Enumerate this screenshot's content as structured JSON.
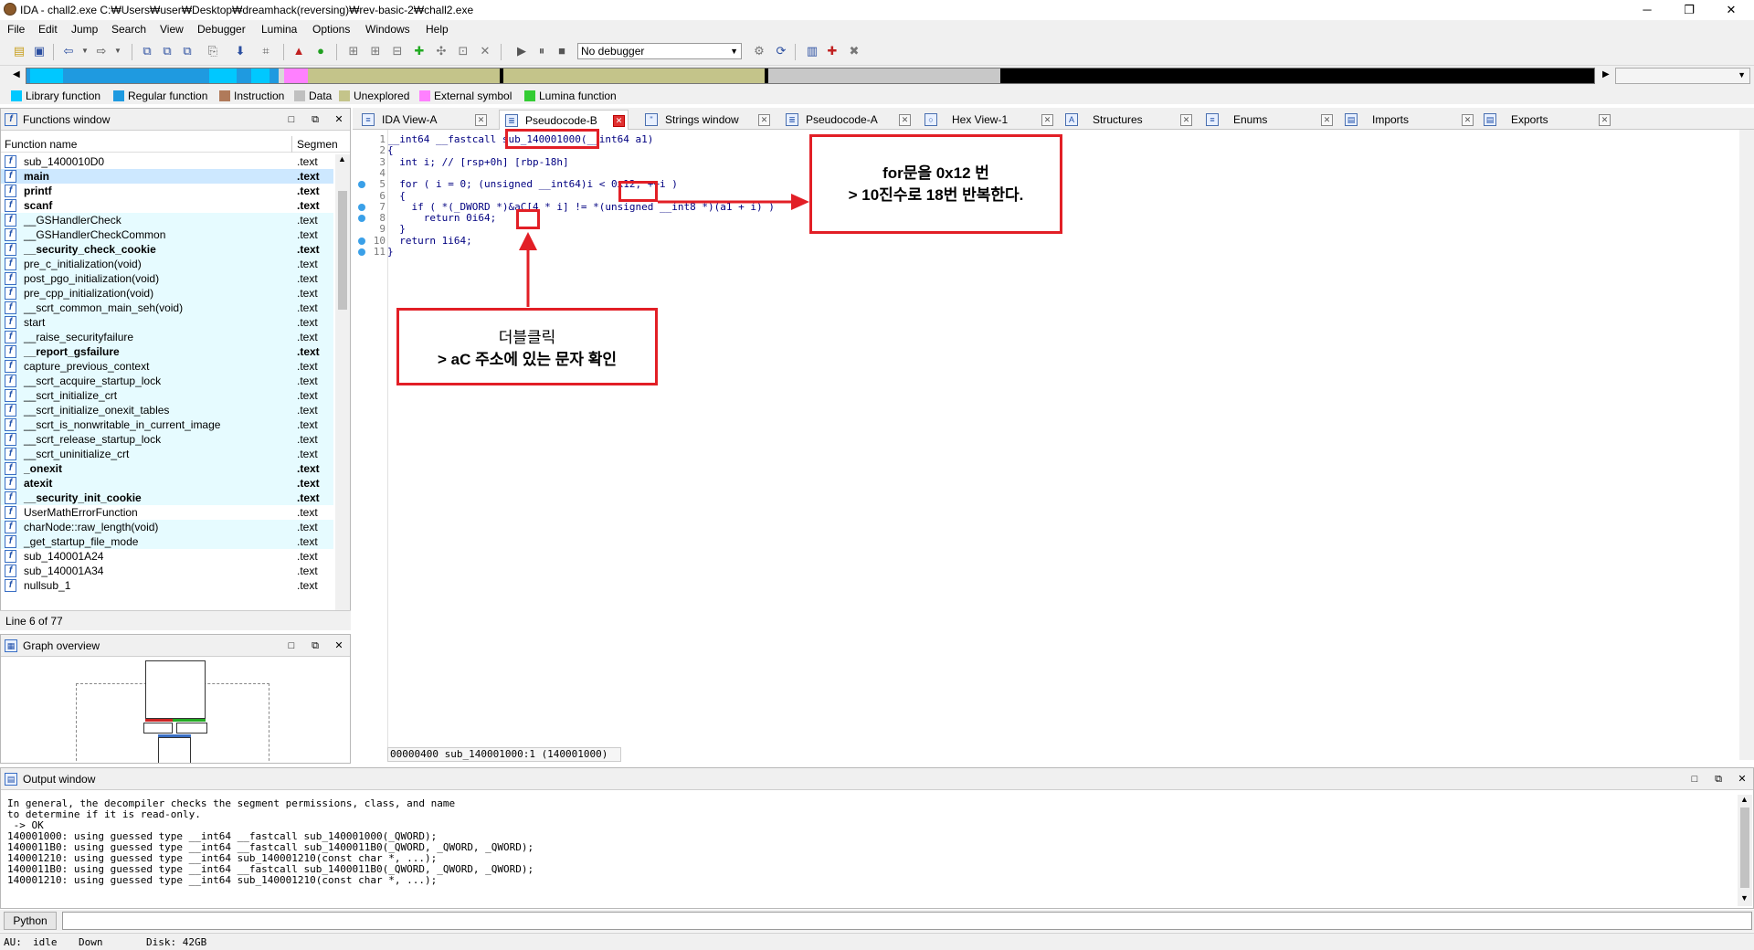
{
  "window": {
    "title": "IDA - chall2.exe C:₩Users₩user₩Desktop₩dreamhack(reversing)₩rev-basic-2₩chall2.exe",
    "minimize": "─",
    "maximize": "❐",
    "close": "✕"
  },
  "menu": [
    "File",
    "Edit",
    "Jump",
    "Search",
    "View",
    "Debugger",
    "Lumina",
    "Options",
    "Windows",
    "Help"
  ],
  "debugger_select": "No debugger",
  "legend": [
    {
      "label": "Library function",
      "color": "#00c8ff"
    },
    {
      "label": "Regular function",
      "color": "#1f9ae0"
    },
    {
      "label": "Instruction",
      "color": "#b07a5a"
    },
    {
      "label": "Data",
      "color": "#c0c0c0"
    },
    {
      "label": "Unexplored",
      "color": "#c4c48a"
    },
    {
      "label": "External symbol",
      "color": "#ff80ff"
    },
    {
      "label": "Lumina function",
      "color": "#33cc33"
    }
  ],
  "functions_window": {
    "title": "Functions window",
    "col_name": "Function name",
    "col_segment": "Segmen",
    "rows": [
      {
        "name": "sub_1400010D0",
        "seg": ".text",
        "lib": false,
        "bold": false
      },
      {
        "name": "main",
        "seg": ".text",
        "lib": false,
        "bold": true
      },
      {
        "name": "printf",
        "seg": ".text",
        "lib": false,
        "bold": true
      },
      {
        "name": "scanf",
        "seg": ".text",
        "lib": false,
        "bold": true
      },
      {
        "name": "__GSHandlerCheck",
        "seg": ".text",
        "lib": true,
        "bold": false
      },
      {
        "name": "__GSHandlerCheckCommon",
        "seg": ".text",
        "lib": true,
        "bold": false
      },
      {
        "name": "__security_check_cookie",
        "seg": ".text",
        "lib": true,
        "bold": true
      },
      {
        "name": "pre_c_initialization(void)",
        "seg": ".text",
        "lib": true,
        "bold": false
      },
      {
        "name": "post_pgo_initialization(void)",
        "seg": ".text",
        "lib": true,
        "bold": false
      },
      {
        "name": "pre_cpp_initialization(void)",
        "seg": ".text",
        "lib": true,
        "bold": false
      },
      {
        "name": "__scrt_common_main_seh(void)",
        "seg": ".text",
        "lib": true,
        "bold": false
      },
      {
        "name": "start",
        "seg": ".text",
        "lib": true,
        "bold": false
      },
      {
        "name": "__raise_securityfailure",
        "seg": ".text",
        "lib": true,
        "bold": false
      },
      {
        "name": "__report_gsfailure",
        "seg": ".text",
        "lib": true,
        "bold": true
      },
      {
        "name": "capture_previous_context",
        "seg": ".text",
        "lib": true,
        "bold": false
      },
      {
        "name": "__scrt_acquire_startup_lock",
        "seg": ".text",
        "lib": true,
        "bold": false
      },
      {
        "name": "__scrt_initialize_crt",
        "seg": ".text",
        "lib": true,
        "bold": false
      },
      {
        "name": "__scrt_initialize_onexit_tables",
        "seg": ".text",
        "lib": true,
        "bold": false
      },
      {
        "name": "__scrt_is_nonwritable_in_current_image",
        "seg": ".text",
        "lib": true,
        "bold": false
      },
      {
        "name": "__scrt_release_startup_lock",
        "seg": ".text",
        "lib": true,
        "bold": false
      },
      {
        "name": "__scrt_uninitialize_crt",
        "seg": ".text",
        "lib": true,
        "bold": false
      },
      {
        "name": "_onexit",
        "seg": ".text",
        "lib": true,
        "bold": true
      },
      {
        "name": "atexit",
        "seg": ".text",
        "lib": true,
        "bold": true
      },
      {
        "name": "__security_init_cookie",
        "seg": ".text",
        "lib": true,
        "bold": true
      },
      {
        "name": "UserMathErrorFunction",
        "seg": ".text",
        "lib": false,
        "bold": false
      },
      {
        "name": "charNode::raw_length(void)",
        "seg": ".text",
        "lib": true,
        "bold": false
      },
      {
        "name": "_get_startup_file_mode",
        "seg": ".text",
        "lib": true,
        "bold": false
      },
      {
        "name": "sub_140001A24",
        "seg": ".text",
        "lib": false,
        "bold": false
      },
      {
        "name": "sub_140001A34",
        "seg": ".text",
        "lib": false,
        "bold": false
      },
      {
        "name": "nullsub_1",
        "seg": ".text",
        "lib": false,
        "bold": false
      }
    ],
    "line_status": "Line 6 of 77"
  },
  "graph_overview": {
    "title": "Graph overview"
  },
  "tabs": [
    {
      "label": "IDA View-A",
      "active": false
    },
    {
      "label": "Pseudocode-B",
      "active": true
    },
    {
      "label": "Strings window",
      "active": false
    },
    {
      "label": "Pseudocode-A",
      "active": false
    },
    {
      "label": "Hex View-1",
      "active": false
    },
    {
      "label": "Structures",
      "active": false
    },
    {
      "label": "Enums",
      "active": false
    },
    {
      "label": "Imports",
      "active": false
    },
    {
      "label": "Exports",
      "active": false
    }
  ],
  "code": {
    "lines": [
      {
        "num": "1",
        "text": "__int64 __fastcall sub_140001000(__int64 a1)",
        "bp": false
      },
      {
        "num": "2",
        "text": "{",
        "bp": false
      },
      {
        "num": "3",
        "text": "  int i; // [rsp+0h] [rbp-18h]",
        "bp": false
      },
      {
        "num": "4",
        "text": "",
        "bp": false
      },
      {
        "num": "5",
        "text": "  for ( i = 0; (unsigned __int64)i < 0x12; ++i )",
        "bp": true
      },
      {
        "num": "6",
        "text": "  {",
        "bp": false
      },
      {
        "num": "7",
        "text": "    if ( *(_DWORD *)&aC[4 * i] != *(unsigned __int8 *)(a1 + i) )",
        "bp": true
      },
      {
        "num": "8",
        "text": "      return 0i64;",
        "bp": true
      },
      {
        "num": "9",
        "text": "  }",
        "bp": false
      },
      {
        "num": "10",
        "text": "  return 1i64;",
        "bp": true
      },
      {
        "num": "11",
        "text": "}",
        "bp": true
      }
    ],
    "status": "00000400 sub_140001000:1 (140001000)"
  },
  "annotations": {
    "loop_note_line1": "for문을 0x12 번",
    "loop_note_line2": "> 10진수로 18번 반복한다.",
    "click_note_line1": "더블클릭",
    "click_note_line2": "> aC 주소에 있는 문자 확인"
  },
  "output_window": {
    "title": "Output window",
    "lines": [
      "In general, the decompiler checks the segment permissions, class, and name",
      "to determine if it is read-only.",
      " -> OK",
      "140001000: using guessed type __int64 __fastcall sub_140001000(_QWORD);",
      "1400011B0: using guessed type __int64 __fastcall sub_1400011B0(_QWORD, _QWORD, _QWORD);",
      "140001210: using guessed type __int64 sub_140001210(const char *, ...);",
      "1400011B0: using guessed type __int64 __fastcall sub_1400011B0(_QWORD, _QWORD, _QWORD);",
      "140001210: using guessed type __int64 sub_140001210(const char *, ...);"
    ]
  },
  "python_button": "Python",
  "statusbar": {
    "au": "AU:",
    "state": "idle",
    "direction": "Down",
    "disk": "Disk: 42GB"
  }
}
